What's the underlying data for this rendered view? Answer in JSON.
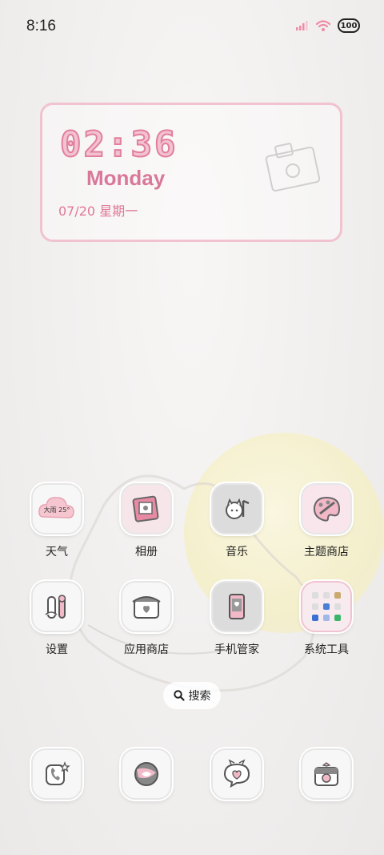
{
  "status_bar": {
    "time": "8:16",
    "battery": "100"
  },
  "widget": {
    "time": "02:36",
    "day": "Monday",
    "date": "07/20  星期一"
  },
  "apps_row1": [
    {
      "label": "天气",
      "icon": "weather-icon",
      "badge": "大雨 25°"
    },
    {
      "label": "相册",
      "icon": "gallery-icon"
    },
    {
      "label": "音乐",
      "icon": "music-icon"
    },
    {
      "label": "主题商店",
      "icon": "theme-store-icon"
    }
  ],
  "apps_row2": [
    {
      "label": "设置",
      "icon": "settings-icon"
    },
    {
      "label": "应用商店",
      "icon": "app-store-icon"
    },
    {
      "label": "手机管家",
      "icon": "phone-manager-icon"
    },
    {
      "label": "系统工具",
      "icon": "system-tools-folder-icon"
    }
  ],
  "search": {
    "label": "搜索"
  },
  "dock": [
    {
      "icon": "phone-icon"
    },
    {
      "icon": "browser-icon"
    },
    {
      "icon": "messages-icon"
    },
    {
      "icon": "camera-icon"
    }
  ],
  "colors": {
    "accent_pink": "#e27f9e",
    "widget_border": "#f1c2d0"
  }
}
